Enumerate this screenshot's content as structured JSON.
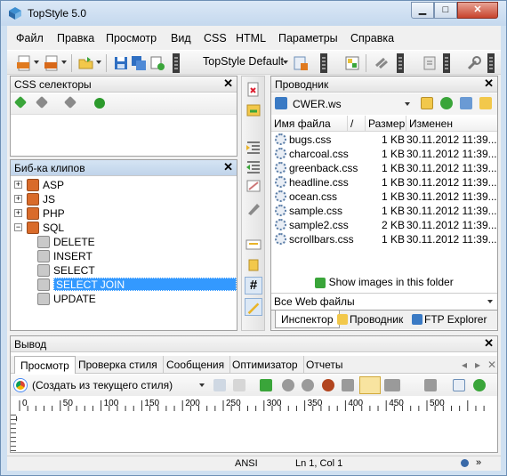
{
  "window": {
    "title": "TopStyle 5.0",
    "min_glyph": "▁",
    "max_glyph": "□",
    "close_glyph": "✕"
  },
  "menu": [
    "Файл",
    "Правка",
    "Просмотр",
    "Вид",
    "CSS",
    "HTML",
    "Параметры",
    "Справка"
  ],
  "toolbar": {
    "style_preset": "TopStyle Default",
    "icons": [
      "css-file-icon",
      "html-file-icon",
      "open-folder-icon",
      "save-icon",
      "save-all-icon",
      "preview-icon",
      "style-preset-icon",
      "color-picker-icon",
      "link-icon",
      "validate-icon",
      "tools-icon"
    ]
  },
  "css_panel": {
    "title": "CSS селекторы",
    "close": "✕"
  },
  "clips_panel": {
    "title": "Биб-ка клипов",
    "close": "✕",
    "items": [
      {
        "label": "ASP",
        "level": 0,
        "expander": "+"
      },
      {
        "label": "JS",
        "level": 0,
        "expander": "+"
      },
      {
        "label": "PHP",
        "level": 0,
        "expander": "+"
      },
      {
        "label": "SQL",
        "level": 0,
        "expander": "−"
      },
      {
        "label": "DELETE",
        "level": 1,
        "expander": ""
      },
      {
        "label": "INSERT",
        "level": 1,
        "expander": ""
      },
      {
        "label": "SELECT",
        "level": 1,
        "expander": ""
      },
      {
        "label": "SELECT JOIN",
        "level": 1,
        "expander": "",
        "selected": true
      },
      {
        "label": "UPDATE",
        "level": 1,
        "expander": ""
      }
    ]
  },
  "explorer": {
    "title": "Проводник",
    "close": "✕",
    "workspace": "CWER.ws",
    "columns": [
      "Имя файла",
      "/",
      "Размер",
      "Изменен"
    ],
    "files": [
      {
        "name": "bugs.css",
        "size": "1 KB",
        "modified": "30.11.2012 11:39..."
      },
      {
        "name": "charcoal.css",
        "size": "1 KB",
        "modified": "30.11.2012 11:39..."
      },
      {
        "name": "greenback.css",
        "size": "1 KB",
        "modified": "30.11.2012 11:39..."
      },
      {
        "name": "headline.css",
        "size": "1 KB",
        "modified": "30.11.2012 11:39..."
      },
      {
        "name": "ocean.css",
        "size": "1 KB",
        "modified": "30.11.2012 11:39..."
      },
      {
        "name": "sample.css",
        "size": "1 KB",
        "modified": "30.11.2012 11:39..."
      },
      {
        "name": "sample2.css",
        "size": "2 KB",
        "modified": "30.11.2012 11:39..."
      },
      {
        "name": "scrollbars.css",
        "size": "1 KB",
        "modified": "30.11.2012 11:39..."
      }
    ],
    "show_images": "Show images in this folder",
    "filter": "Все Web файлы",
    "tabs": [
      "Инспектор",
      "Проводник",
      "FTP Explorer"
    ]
  },
  "vertical_toolbar": {
    "hash_label": "#"
  },
  "output": {
    "title": "Вывод",
    "close": "✕",
    "tabs": [
      "Просмотр",
      "Проверка стиля",
      "Сообщения",
      "Оптимизатор",
      "Отчеты"
    ],
    "nav_left": "◂",
    "nav_right": "▸",
    "nav_close": "✕",
    "source": "(Создать из текущего стиля)",
    "ruler": [
      "0",
      "50",
      "100",
      "150",
      "200",
      "250",
      "300",
      "350",
      "400",
      "450",
      "500"
    ],
    "ruler_v": "0"
  },
  "status": {
    "encoding": "ANSI",
    "position": "Ln 1, Col 1",
    "more": "»"
  }
}
